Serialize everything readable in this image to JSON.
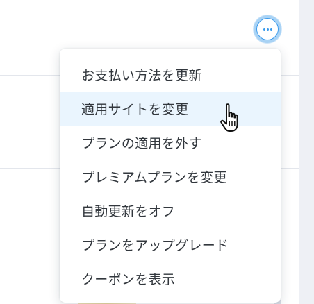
{
  "more_button": {
    "icon": "more-horizontal-icon",
    "accent": "#3899ec"
  },
  "menu": {
    "items": [
      {
        "label": "お支払い方法を更新",
        "highlighted": false
      },
      {
        "label": "適用サイトを変更",
        "highlighted": true
      },
      {
        "label": "プランの適用を外す",
        "highlighted": false
      },
      {
        "label": "プレミアムプランを変更",
        "highlighted": false
      },
      {
        "label": "自動更新をオフ",
        "highlighted": false
      },
      {
        "label": "プランをアップグレード",
        "highlighted": false
      },
      {
        "label": "クーポンを表示",
        "highlighted": false
      }
    ],
    "highlight_color": "#eaf5fe",
    "text_color": "#32373d"
  },
  "cursor": {
    "icon": "hand-pointer-icon"
  }
}
